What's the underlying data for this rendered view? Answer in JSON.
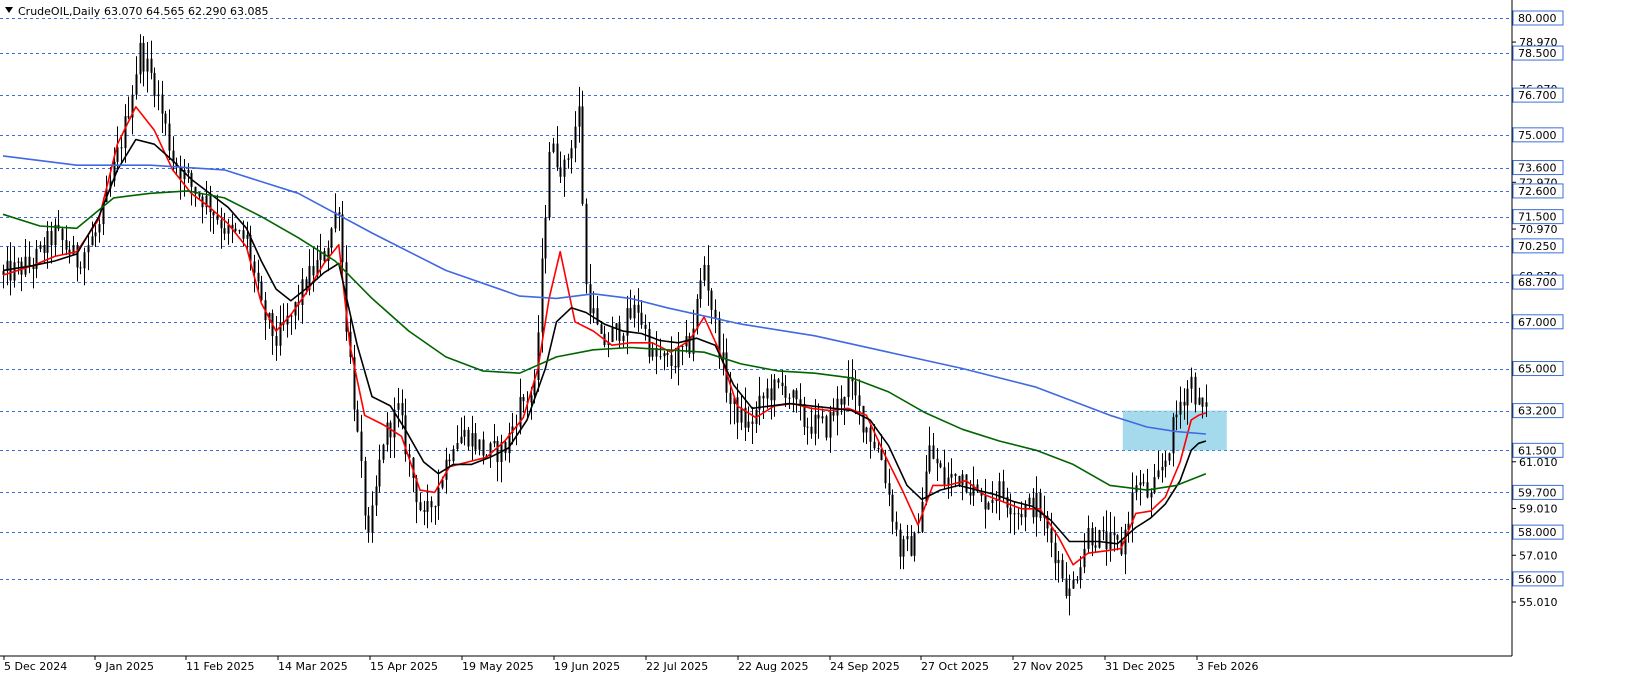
{
  "header": {
    "symbol_label": "CrudeOIL,Daily",
    "ohlc_label": "63.070 64.565 62.290 63.085"
  },
  "colors": {
    "background": "#ffffff",
    "grid": "#3c6fd8",
    "candle": "#000000",
    "ma_red": "#ff0000",
    "ma_black": "#000000",
    "ma_green": "#006400",
    "ma_blue": "#4169e1",
    "highlight_zone": "#87cde6",
    "level_box_border": "#3c6fd8"
  },
  "chart_data": {
    "type": "candlestick",
    "title": "CrudeOIL,Daily",
    "ylim": [
      54.4,
      80.7
    ],
    "grid": true,
    "x_tick_labels": [
      "5 Dec 2024",
      "9 Jan 2025",
      "11 Feb 2025",
      "14 Mar 2025",
      "15 Apr 2025",
      "19 May 2025",
      "19 Jun 2025",
      "22 Jul 2025",
      "22 Aug 2025",
      "24 Sep 2025",
      "27 Oct 2025",
      "27 Nov 2025",
      "31 Dec 2025",
      "3 Feb 2026"
    ],
    "y_tick_labels": [
      "78.970",
      "76.970",
      "72.970",
      "70.970",
      "68.970",
      "61.010",
      "59.010",
      "57.010",
      "55.010"
    ],
    "level_labels": [
      "80.000",
      "78.500",
      "76.700",
      "75.000",
      "73.600",
      "72.600",
      "71.500",
      "70.250",
      "68.700",
      "67.000",
      "65.000",
      "63.200",
      "61.500",
      "59.700",
      "58.000",
      "56.000"
    ],
    "levels": [
      80.0,
      78.5,
      76.7,
      75.0,
      73.6,
      72.6,
      71.5,
      70.25,
      68.7,
      67.0,
      65.0,
      63.2,
      61.5,
      59.7,
      58.0,
      56.0
    ],
    "close_path": [
      [
        0,
        69.0
      ],
      [
        8,
        69.5
      ],
      [
        14,
        70.8
      ],
      [
        20,
        69.6
      ],
      [
        26,
        71.0
      ],
      [
        33,
        75.4
      ],
      [
        37,
        78.6
      ],
      [
        41,
        77.2
      ],
      [
        46,
        74.0
      ],
      [
        51,
        72.8
      ],
      [
        56,
        72.0
      ],
      [
        61,
        70.8
      ],
      [
        66,
        70.5
      ],
      [
        70,
        67.5
      ],
      [
        74,
        66.2
      ],
      [
        78,
        67.2
      ],
      [
        82,
        68.7
      ],
      [
        87,
        69.9
      ],
      [
        91,
        72.1
      ],
      [
        93,
        67.0
      ],
      [
        96,
        62.0
      ],
      [
        99,
        57.5
      ],
      [
        103,
        62.0
      ],
      [
        107,
        63.2
      ],
      [
        110,
        61.0
      ],
      [
        114,
        58.4
      ],
      [
        118,
        60.0
      ],
      [
        122,
        62.0
      ],
      [
        126,
        62.2
      ],
      [
        131,
        61.3
      ],
      [
        136,
        61.6
      ],
      [
        140,
        63.5
      ],
      [
        144,
        64.0
      ],
      [
        148,
        74.5
      ],
      [
        152,
        73.5
      ],
      [
        156,
        76.0
      ],
      [
        158,
        68.5
      ],
      [
        162,
        66.0
      ],
      [
        167,
        66.7
      ],
      [
        172,
        67.6
      ],
      [
        176,
        65.5
      ],
      [
        181,
        65.2
      ],
      [
        186,
        66.0
      ],
      [
        190,
        69.5
      ],
      [
        193,
        66.8
      ],
      [
        197,
        63.5
      ],
      [
        202,
        62.5
      ],
      [
        207,
        64.0
      ],
      [
        212,
        64.2
      ],
      [
        217,
        62.7
      ],
      [
        223,
        62.5
      ],
      [
        229,
        64.4
      ],
      [
        233,
        62.8
      ],
      [
        238,
        61.2
      ],
      [
        243,
        57.2
      ],
      [
        247,
        57.5
      ],
      [
        251,
        61.5
      ],
      [
        255,
        60.2
      ],
      [
        260,
        60.5
      ],
      [
        265,
        59.3
      ],
      [
        270,
        59.8
      ],
      [
        275,
        58.9
      ],
      [
        280,
        59.2
      ],
      [
        285,
        57.2
      ],
      [
        289,
        55.3
      ],
      [
        294,
        58.0
      ],
      [
        298,
        57.6
      ],
      [
        303,
        57.3
      ],
      [
        307,
        60.2
      ],
      [
        311,
        59.4
      ],
      [
        315,
        61.2
      ],
      [
        319,
        63.6
      ],
      [
        322,
        64.5
      ],
      [
        324,
        63.4
      ],
      [
        326,
        63.1
      ]
    ],
    "series": [
      {
        "values": [
          [
            0,
            69.0
          ],
          [
            8,
            69.4
          ],
          [
            14,
            69.8
          ],
          [
            20,
            70.0
          ],
          [
            26,
            71.4
          ],
          [
            31,
            74.6
          ],
          [
            36,
            76.2
          ],
          [
            41,
            75.2
          ],
          [
            46,
            73.5
          ],
          [
            51,
            72.5
          ],
          [
            56,
            71.9
          ],
          [
            61,
            71.2
          ],
          [
            66,
            70.2
          ],
          [
            70,
            67.8
          ],
          [
            74,
            66.6
          ],
          [
            78,
            67.3
          ],
          [
            82,
            68.2
          ],
          [
            87,
            69.5
          ],
          [
            91,
            70.3
          ],
          [
            94,
            66.0
          ],
          [
            98,
            63.0
          ],
          [
            103,
            62.6
          ],
          [
            108,
            62.1
          ],
          [
            113,
            59.8
          ],
          [
            117,
            59.7
          ],
          [
            121,
            60.8
          ],
          [
            126,
            61.0
          ],
          [
            131,
            61.2
          ],
          [
            136,
            61.9
          ],
          [
            141,
            62.9
          ],
          [
            145,
            65.0
          ],
          [
            148,
            68.0
          ],
          [
            151,
            70.0
          ],
          [
            155,
            67.0
          ],
          [
            160,
            66.6
          ],
          [
            165,
            66.0
          ],
          [
            170,
            66.1
          ],
          [
            176,
            66.1
          ],
          [
            181,
            65.7
          ],
          [
            186,
            66.2
          ],
          [
            190,
            67.2
          ],
          [
            194,
            65.8
          ],
          [
            199,
            63.4
          ],
          [
            204,
            62.9
          ],
          [
            209,
            63.4
          ],
          [
            214,
            63.5
          ],
          [
            219,
            63.3
          ],
          [
            224,
            63.2
          ],
          [
            229,
            63.3
          ],
          [
            234,
            63.0
          ],
          [
            239,
            61.3
          ],
          [
            244,
            59.7
          ],
          [
            248,
            58.3
          ],
          [
            252,
            60.0
          ],
          [
            256,
            60.0
          ],
          [
            261,
            60.2
          ],
          [
            266,
            59.6
          ],
          [
            271,
            59.3
          ],
          [
            276,
            59.0
          ],
          [
            281,
            59.0
          ],
          [
            286,
            57.8
          ],
          [
            290,
            56.6
          ],
          [
            294,
            57.1
          ],
          [
            299,
            57.2
          ],
          [
            303,
            57.3
          ],
          [
            307,
            58.8
          ],
          [
            311,
            58.9
          ],
          [
            315,
            59.5
          ],
          [
            319,
            61.0
          ],
          [
            322,
            62.8
          ],
          [
            324,
            63.0
          ],
          [
            326,
            63.1
          ]
        ]
      },
      {
        "values": [
          [
            0,
            69.2
          ],
          [
            8,
            69.4
          ],
          [
            14,
            69.6
          ],
          [
            20,
            69.9
          ],
          [
            26,
            71.5
          ],
          [
            31,
            73.5
          ],
          [
            36,
            74.8
          ],
          [
            41,
            74.6
          ],
          [
            46,
            73.9
          ],
          [
            51,
            73.1
          ],
          [
            56,
            72.5
          ],
          [
            61,
            71.9
          ],
          [
            66,
            71.0
          ],
          [
            70,
            69.6
          ],
          [
            74,
            68.4
          ],
          [
            78,
            67.9
          ],
          [
            82,
            68.4
          ],
          [
            87,
            69.1
          ],
          [
            91,
            69.5
          ],
          [
            96,
            66.0
          ],
          [
            100,
            63.8
          ],
          [
            105,
            63.4
          ],
          [
            109,
            62.4
          ],
          [
            114,
            61.0
          ],
          [
            118,
            60.5
          ],
          [
            122,
            60.9
          ],
          [
            127,
            60.9
          ],
          [
            132,
            61.2
          ],
          [
            137,
            61.6
          ],
          [
            142,
            62.8
          ],
          [
            147,
            65.0
          ],
          [
            150,
            67.0
          ],
          [
            154,
            67.6
          ],
          [
            158,
            67.4
          ],
          [
            163,
            66.9
          ],
          [
            168,
            66.6
          ],
          [
            173,
            66.5
          ],
          [
            178,
            66.2
          ],
          [
            183,
            66.1
          ],
          [
            188,
            66.3
          ],
          [
            193,
            66.0
          ],
          [
            198,
            64.3
          ],
          [
            203,
            63.3
          ],
          [
            208,
            63.4
          ],
          [
            213,
            63.5
          ],
          [
            219,
            63.4
          ],
          [
            225,
            63.3
          ],
          [
            230,
            63.2
          ],
          [
            235,
            62.8
          ],
          [
            240,
            61.7
          ],
          [
            245,
            60.0
          ],
          [
            249,
            59.4
          ],
          [
            254,
            59.8
          ],
          [
            259,
            60.0
          ],
          [
            264,
            59.8
          ],
          [
            269,
            59.6
          ],
          [
            274,
            59.3
          ],
          [
            279,
            59.1
          ],
          [
            284,
            58.5
          ],
          [
            289,
            57.6
          ],
          [
            293,
            57.6
          ],
          [
            297,
            57.6
          ],
          [
            302,
            57.5
          ],
          [
            307,
            58.2
          ],
          [
            311,
            58.6
          ],
          [
            315,
            59.2
          ],
          [
            319,
            60.2
          ],
          [
            322,
            61.5
          ],
          [
            324,
            61.8
          ],
          [
            326,
            61.9
          ]
        ]
      },
      {
        "values": [
          [
            0,
            71.6
          ],
          [
            10,
            71.1
          ],
          [
            20,
            71.0
          ],
          [
            30,
            72.3
          ],
          [
            40,
            72.5
          ],
          [
            50,
            72.6
          ],
          [
            60,
            72.3
          ],
          [
            70,
            71.5
          ],
          [
            80,
            70.6
          ],
          [
            90,
            69.6
          ],
          [
            100,
            68.0
          ],
          [
            110,
            66.6
          ],
          [
            120,
            65.5
          ],
          [
            130,
            64.9
          ],
          [
            140,
            64.8
          ],
          [
            150,
            65.5
          ],
          [
            160,
            65.8
          ],
          [
            170,
            65.9
          ],
          [
            180,
            65.8
          ],
          [
            190,
            65.7
          ],
          [
            200,
            65.2
          ],
          [
            210,
            64.9
          ],
          [
            220,
            64.8
          ],
          [
            230,
            64.6
          ],
          [
            240,
            64.0
          ],
          [
            250,
            63.1
          ],
          [
            260,
            62.4
          ],
          [
            270,
            61.9
          ],
          [
            280,
            61.5
          ],
          [
            290,
            60.9
          ],
          [
            300,
            60.0
          ],
          [
            310,
            59.8
          ],
          [
            318,
            60.0
          ],
          [
            326,
            60.5
          ]
        ]
      },
      {
        "values": [
          [
            0,
            74.1
          ],
          [
            20,
            73.7
          ],
          [
            40,
            73.7
          ],
          [
            60,
            73.5
          ],
          [
            80,
            72.5
          ],
          [
            100,
            70.8
          ],
          [
            120,
            69.2
          ],
          [
            140,
            68.1
          ],
          [
            150,
            68.0
          ],
          [
            160,
            68.2
          ],
          [
            170,
            68.0
          ],
          [
            180,
            67.6
          ],
          [
            200,
            66.9
          ],
          [
            220,
            66.4
          ],
          [
            240,
            65.7
          ],
          [
            260,
            65.0
          ],
          [
            280,
            64.2
          ],
          [
            300,
            63.0
          ],
          [
            310,
            62.5
          ],
          [
            318,
            62.3
          ],
          [
            326,
            62.2
          ]
        ]
      }
    ],
    "highlight_zone": {
      "x_start": 304,
      "x_end": 320,
      "y_low": 61.5,
      "y_high": 63.2
    }
  }
}
